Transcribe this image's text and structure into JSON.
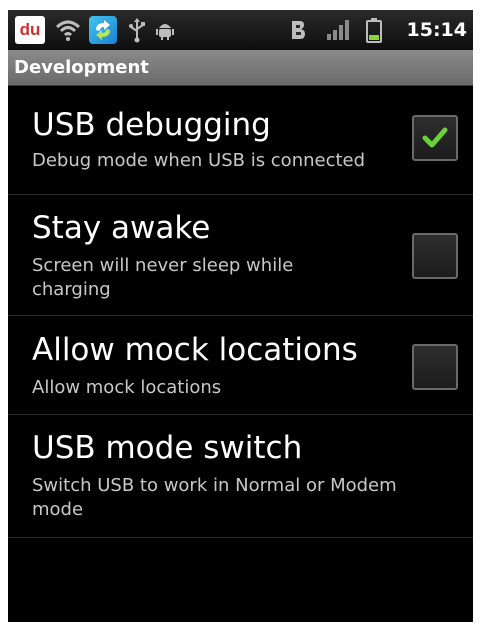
{
  "status_bar": {
    "notification_icons": [
      "du-app-icon",
      "wifi-icon",
      "sync-app-icon",
      "usb-icon",
      "android-debug-icon"
    ],
    "system_icons": [
      "bbm-icon",
      "signal-icon",
      "battery-icon"
    ],
    "du_label": "du",
    "time": "15:14",
    "battery_color": "#8bd33a"
  },
  "title_bar": {
    "title": "Development"
  },
  "preferences": [
    {
      "title": "USB debugging",
      "summary": "Debug mode when USB is connected",
      "checked": true
    },
    {
      "title": "Stay awake",
      "summary": "Screen will never sleep while charging",
      "checked": false
    },
    {
      "title": "Allow mock locations",
      "summary": "Allow mock locations",
      "checked": false
    },
    {
      "title": "USB mode switch",
      "summary": "Switch USB to work in Normal or Modem mode"
    }
  ],
  "colors": {
    "checkmark": "#6bd13a",
    "background": "#000000",
    "title_bar": "#7a7a7a"
  }
}
